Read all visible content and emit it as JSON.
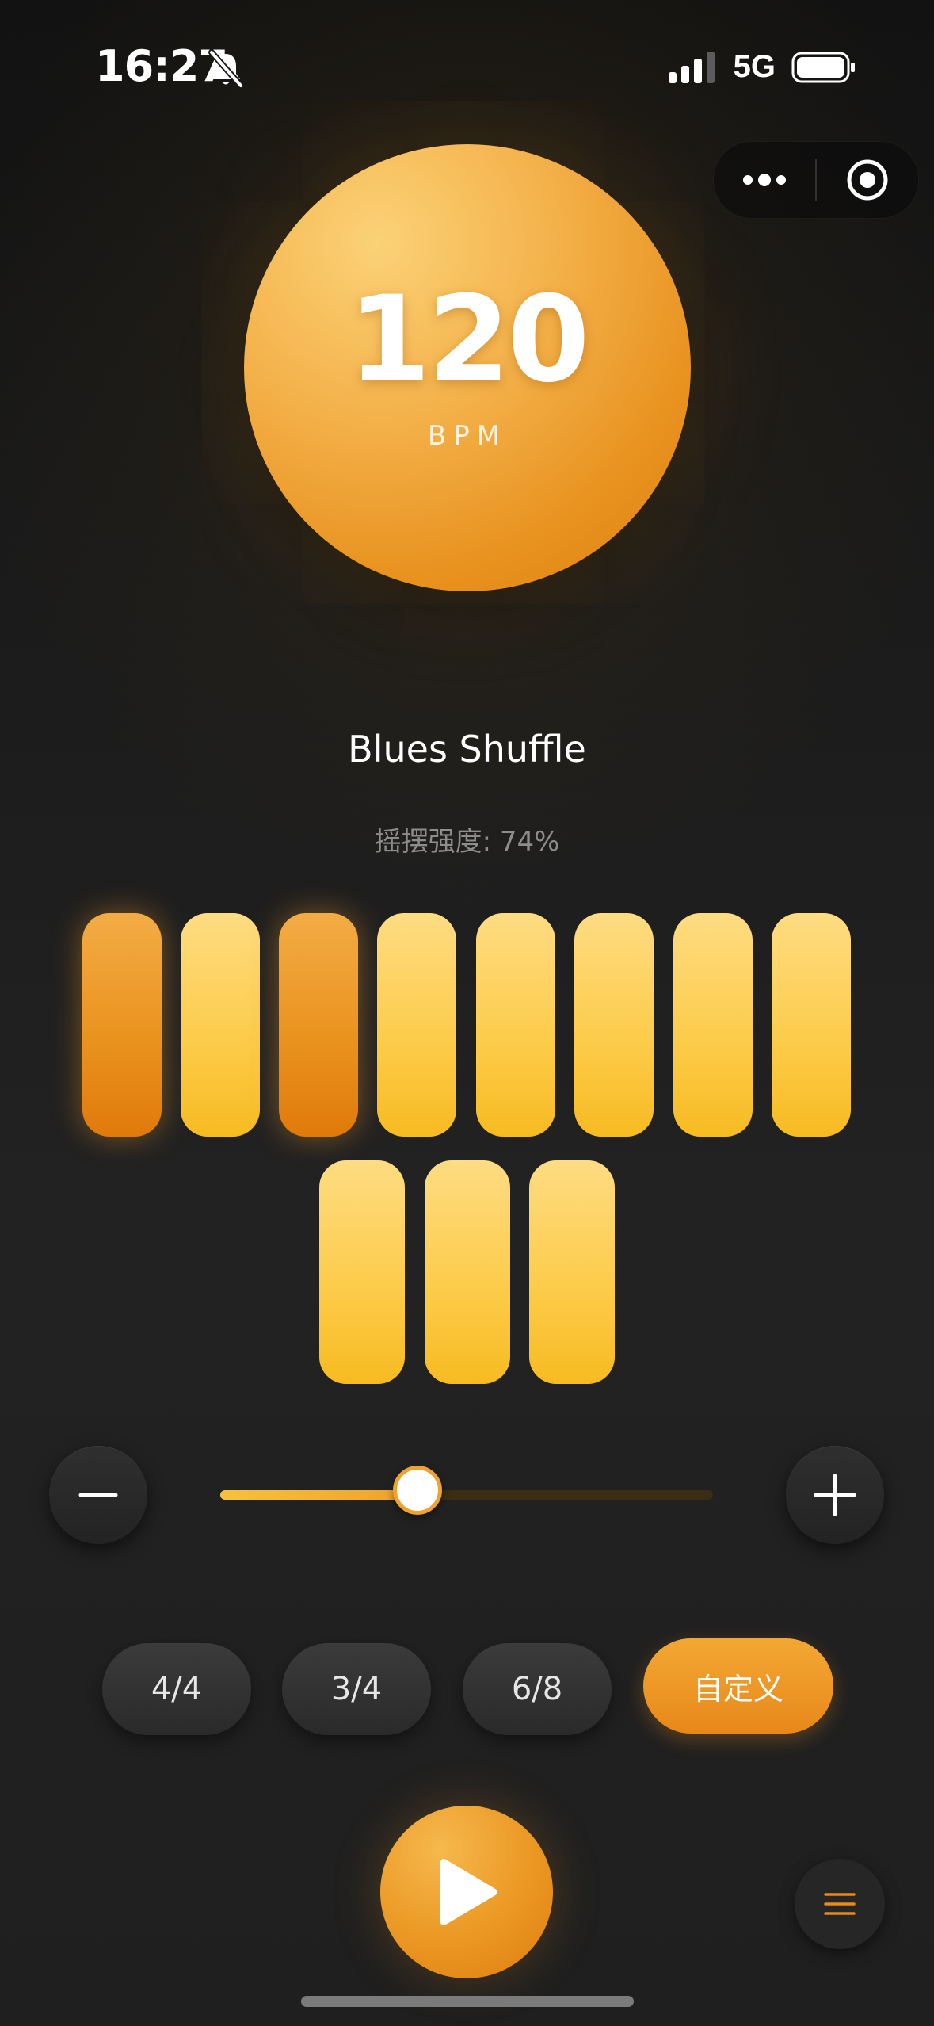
{
  "status_bar": {
    "time": "16:27",
    "network": "5G",
    "icons": [
      "bell-slash-icon",
      "signal-icon",
      "battery-icon"
    ]
  },
  "capsule": {
    "icons": [
      "more-dots-icon",
      "target-close-icon"
    ]
  },
  "tempo": {
    "value": "120",
    "unit": "BPM",
    "slider_level": 0.4
  },
  "pattern": {
    "name": "Blues Shuffle",
    "swing_label": "摇摆强度: 74%"
  },
  "beats": [
    {
      "accent": true
    },
    {
      "accent": false
    },
    {
      "accent": true
    },
    {
      "accent": false
    },
    {
      "accent": false
    },
    {
      "accent": false
    },
    {
      "accent": false
    },
    {
      "accent": false
    },
    {
      "accent": false
    },
    {
      "accent": false
    },
    {
      "accent": false
    }
  ],
  "time_signatures": [
    {
      "label": "4/4",
      "active": false
    },
    {
      "label": "3/4",
      "active": false
    },
    {
      "label": "6/8",
      "active": false
    },
    {
      "label": "自定义",
      "active": true
    }
  ],
  "controls": {
    "decrease_icon": "minus-icon",
    "increase_icon": "plus-icon",
    "play_icon": "play-icon",
    "menu_icon": "hamburger-icon"
  },
  "colors": {
    "accent": "#ec9a26",
    "beat_light": "#fcca45",
    "beat_accent": "#e8881a",
    "background": "#1e1e1e"
  }
}
